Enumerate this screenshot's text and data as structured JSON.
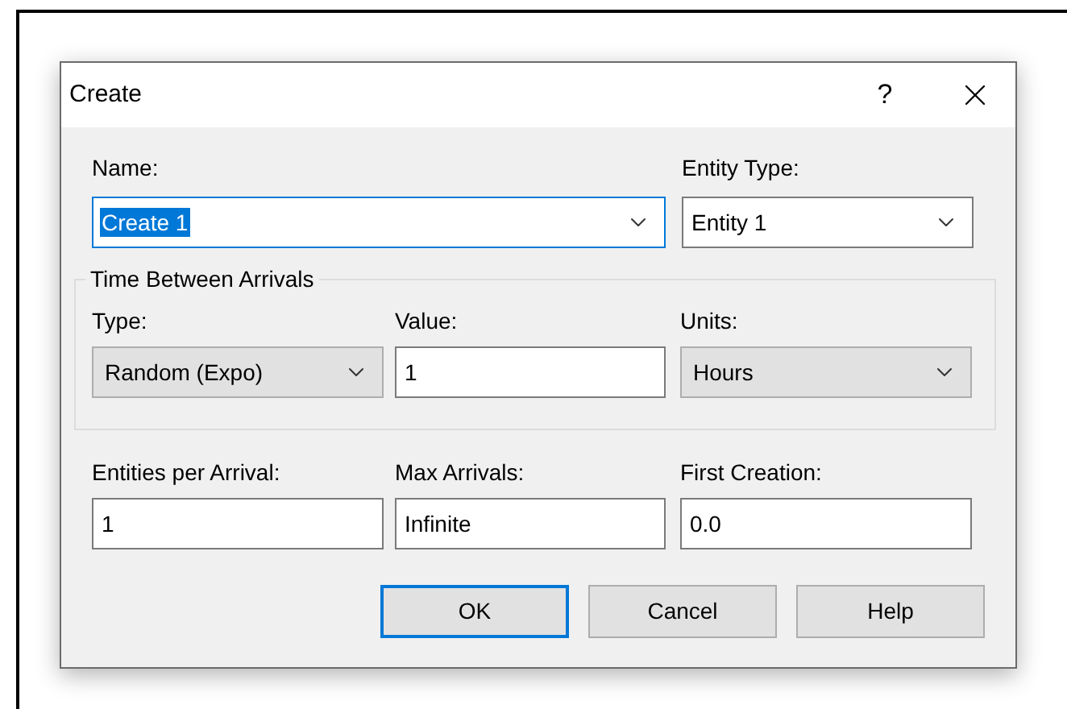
{
  "dialog": {
    "title": "Create",
    "help_glyph": "?"
  },
  "top_fields": [
    {
      "label": "Name:",
      "value": "Create 1",
      "kind": "combo",
      "focused": true
    },
    {
      "label": "Entity Type:",
      "value": "Entity 1",
      "kind": "combo",
      "focused": false
    }
  ],
  "group": {
    "title": "Time Between Arrivals",
    "fields": [
      {
        "label": "Type:",
        "value": "Random (Expo)",
        "kind": "dropdown",
        "focused": false
      },
      {
        "label": "Value:",
        "value": "1",
        "kind": "text",
        "focused": false
      },
      {
        "label": "Units:",
        "value": "Hours",
        "kind": "dropdown",
        "focused": false
      }
    ]
  },
  "bottom_fields": [
    {
      "label": "Entities per Arrival:",
      "value": "1",
      "kind": "text",
      "focused": false
    },
    {
      "label": "Max Arrivals:",
      "value": "Infinite",
      "kind": "text",
      "focused": false
    },
    {
      "label": "First Creation:",
      "value": "0.0",
      "kind": "text",
      "focused": false
    }
  ],
  "buttons": [
    {
      "label": "OK",
      "default": true
    },
    {
      "label": "Cancel",
      "default": false
    },
    {
      "label": "Help",
      "default": false
    }
  ]
}
